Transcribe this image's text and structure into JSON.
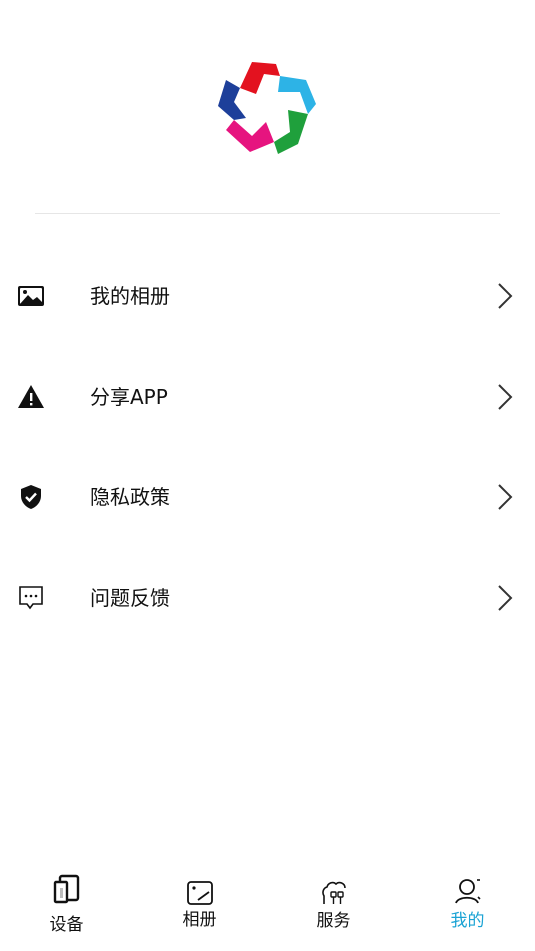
{
  "menu": {
    "items": [
      {
        "label": "我的相册",
        "icon": "image-icon"
      },
      {
        "label": "分享APP",
        "icon": "warning-icon"
      },
      {
        "label": "隐私政策",
        "icon": "shield-check-icon"
      },
      {
        "label": "问题反馈",
        "icon": "message-dots-icon"
      }
    ]
  },
  "tabbar": {
    "items": [
      {
        "label": "设备",
        "icon": "device-icon",
        "active": false
      },
      {
        "label": "相册",
        "icon": "album-icon",
        "active": false
      },
      {
        "label": "服务",
        "icon": "service-icon",
        "active": false
      },
      {
        "label": "我的",
        "icon": "profile-icon",
        "active": true
      }
    ]
  },
  "colors": {
    "accent": "#1aa3d4",
    "logo_red": "#e3121f",
    "logo_blue_light": "#2db3e6",
    "logo_green": "#1fa03c",
    "logo_pink": "#e6147f",
    "logo_blue_dark": "#1d3f9a"
  }
}
